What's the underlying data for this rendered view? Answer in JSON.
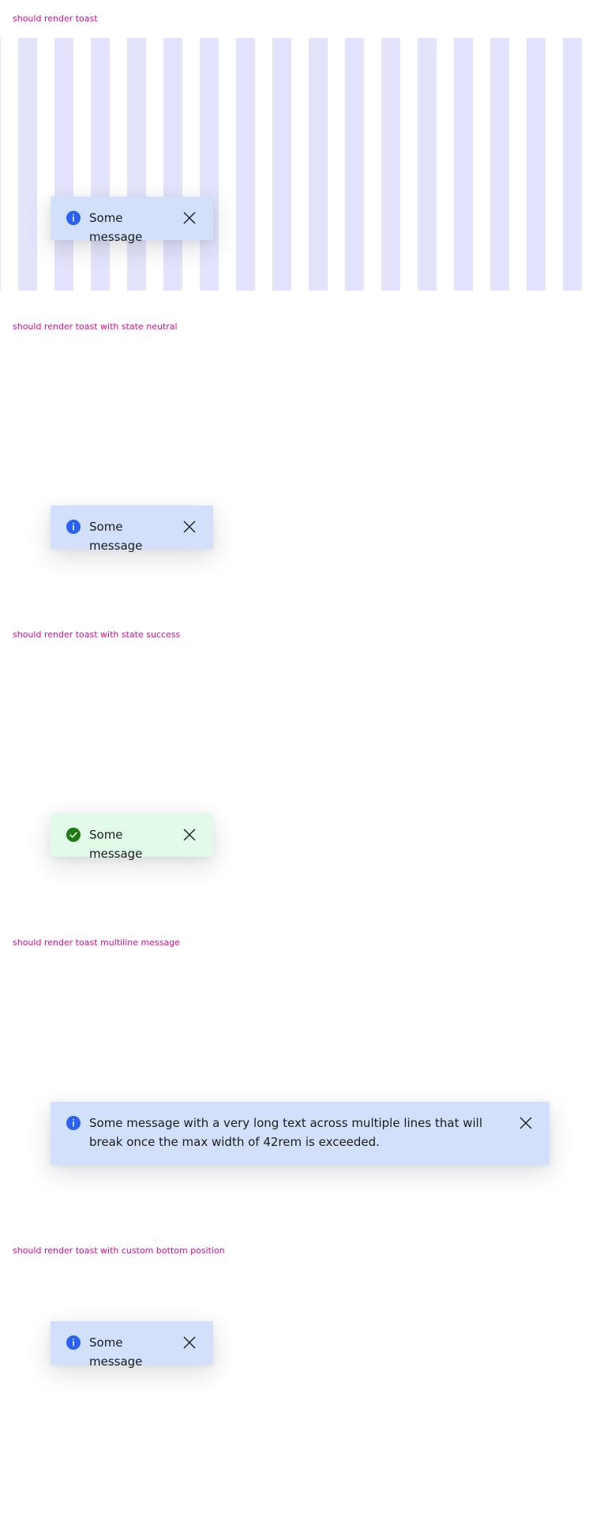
{
  "sections": [
    {
      "label": "should render toast",
      "toast": {
        "state": "info",
        "message": "Some message"
      }
    },
    {
      "label": "should render toast with state neutral",
      "toast": {
        "state": "info",
        "message": "Some message"
      }
    },
    {
      "label": "should render toast with state success",
      "toast": {
        "state": "success",
        "message": "Some message"
      }
    },
    {
      "label": "should render toast multiline message",
      "toast": {
        "state": "info",
        "message": "Some message with a very long text across multiple lines that will break once the max width of 42rem is exceeded."
      }
    },
    {
      "label": "should render toast with custom bottom position",
      "toast": {
        "state": "info",
        "message": "Some message"
      }
    }
  ],
  "icons": {
    "info": "info-icon",
    "success": "check-circle-icon",
    "close": "close-icon"
  },
  "colors": {
    "label": "#e20b8e",
    "info_background": "#d3e0fc",
    "info_icon": "#2a61f0",
    "success_background": "#e2fbe9",
    "success_icon": "#1d7a12",
    "stripe": "#e3e3fb"
  }
}
